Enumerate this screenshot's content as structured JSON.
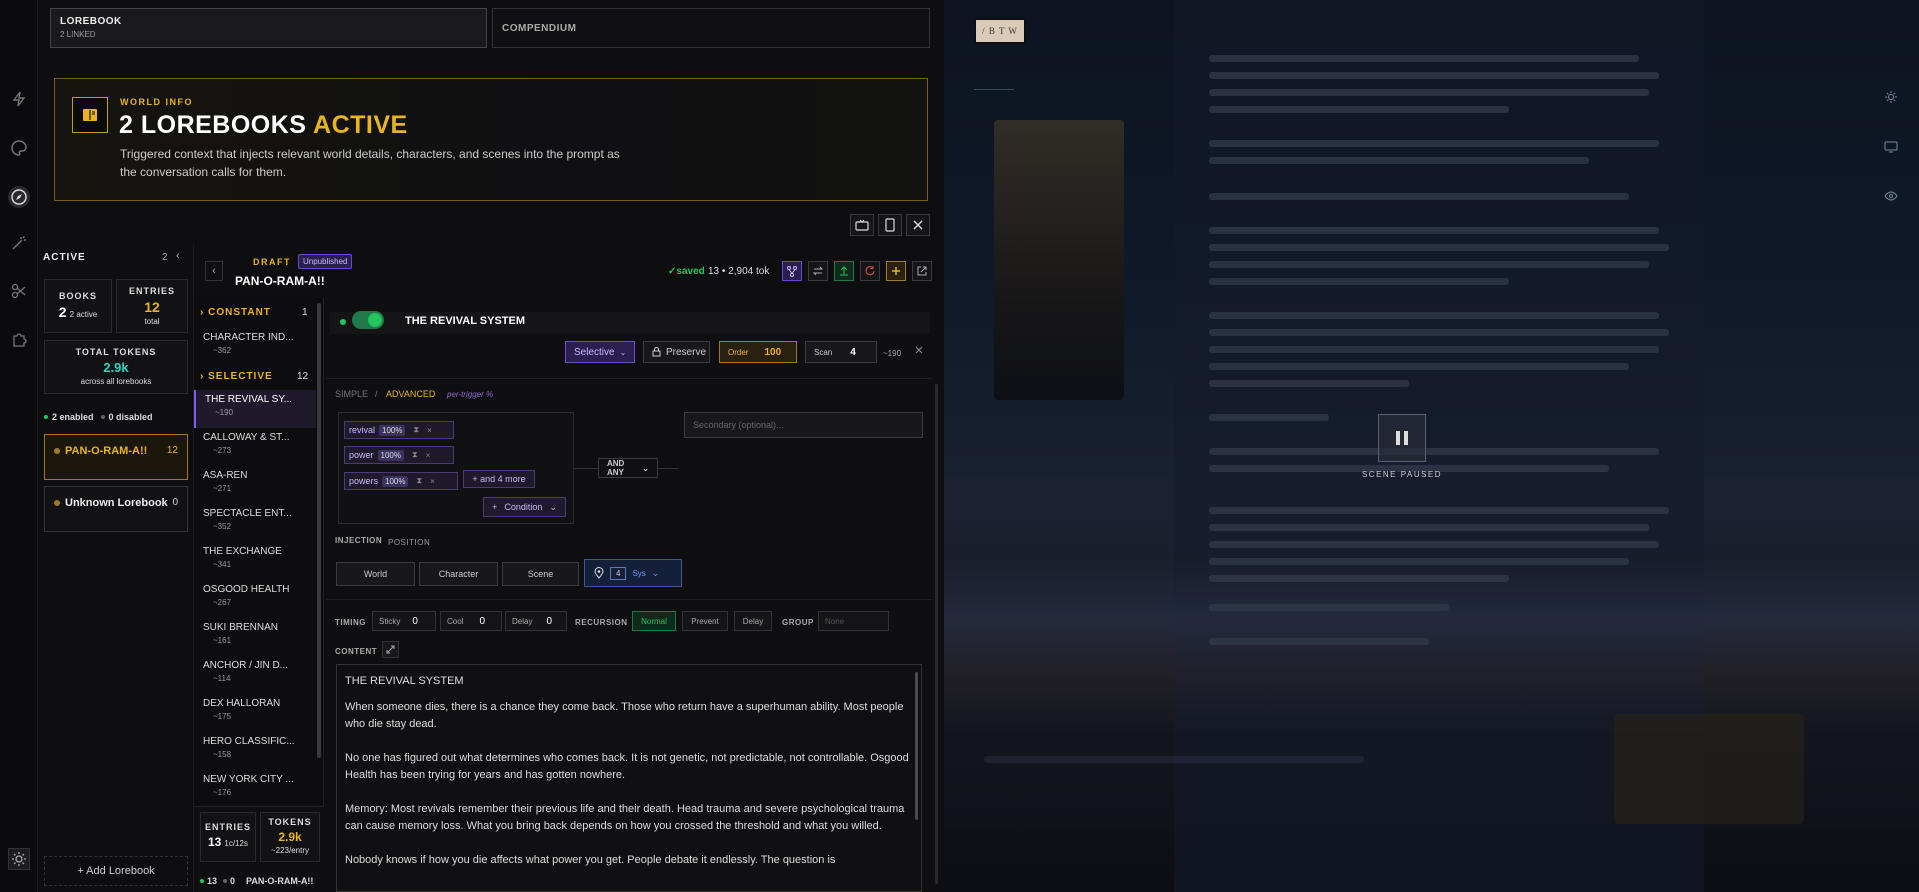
{
  "top_tabs": [
    {
      "label": "LOREBOOK",
      "sub": "2 LINKED"
    },
    {
      "label": "COMPENDIUM",
      "sub": ""
    }
  ],
  "world_info": {
    "eyebrow": "WORLD INFO",
    "title_prefix": "2 LOREBOOKS",
    "title_accent": "ACTIVE",
    "description": "Triggered context that injects relevant world details, characters, and scenes into the prompt as the conversation calls for them."
  },
  "sidebar": {
    "header": "ACTIVE",
    "count": "2",
    "books_label": "BOOKS",
    "books_value": "2",
    "books_sub": "2 active",
    "entries_label": "ENTRIES",
    "entries_value": "12",
    "entries_sub": "total",
    "tokens_label": "TOTAL TOKENS",
    "tokens_value": "2.9k",
    "tokens_sub": "across all lorebooks",
    "enabled": "2 enabled",
    "disabled": "0 disabled",
    "books": [
      {
        "name": "PAN-O-RAM-A!!",
        "count": "12"
      },
      {
        "name": "Unknown Lorebook",
        "count": "0"
      }
    ],
    "add_label": "+ Add Lorebook"
  },
  "editor_header": {
    "draft": "DRAFT",
    "badge": "Unpublished",
    "book_title": "PAN-O-RAM-A!!",
    "saved": "✓saved",
    "stats": "13 • 2,904 tok"
  },
  "entry_list": {
    "constant_label": "CONSTANT",
    "constant_count": "1",
    "selective_label": "SELECTIVE",
    "selective_count": "12",
    "constant": [
      {
        "name": "CHARACTER IND...",
        "tok": "~362"
      }
    ],
    "selective": [
      {
        "name": "THE REVIVAL SY...",
        "tok": "~190"
      },
      {
        "name": "CALLOWAY & ST...",
        "tok": "~273"
      },
      {
        "name": "ASA-REN",
        "tok": "~271"
      },
      {
        "name": "SPECTACLE ENT...",
        "tok": "~352"
      },
      {
        "name": "THE EXCHANGE",
        "tok": "~341"
      },
      {
        "name": "OSGOOD HEALTH",
        "tok": "~267"
      },
      {
        "name": "SUKI BRENNAN",
        "tok": "~161"
      },
      {
        "name": "ANCHOR / JIN D...",
        "tok": "~114"
      },
      {
        "name": "DEX HALLORAN",
        "tok": "~175"
      },
      {
        "name": "HERO CLASSIFIC...",
        "tok": "~158"
      },
      {
        "name": "NEW YORK CITY ...",
        "tok": "~176"
      }
    ],
    "footer_entries_label": "ENTRIES",
    "footer_entries_value": "13",
    "footer_entries_sub": "1c/12s",
    "footer_tokens_label": "TOKENS",
    "footer_tokens_value": "2.9k",
    "footer_tokens_sub": "~223/entry",
    "footer_line_a": "13",
    "footer_line_b": "0",
    "footer_book": "PAN-O-RAM-A!!"
  },
  "entry_editor": {
    "title": "THE REVIVAL SYSTEM",
    "mode": "Selective",
    "preserve": "Preserve",
    "order_label": "Order",
    "order_value": "100",
    "scan_label": "Scan",
    "scan_value": "4",
    "tok": "~190",
    "simple": "SIMPLE",
    "sep": "/",
    "advanced": "ADVANCED",
    "per_trigger": "per-trigger %",
    "keys": [
      {
        "key": "revival",
        "pct": "100%"
      },
      {
        "key": "power",
        "pct": "100%"
      },
      {
        "key": "powers",
        "pct": "100%"
      }
    ],
    "more": "+ and 4 more",
    "condition": "Condition",
    "logic": "AND ANY",
    "secondary_placeholder": "Secondary (optional)...",
    "injection_label": "INJECTION",
    "position_label": "POSITION",
    "inj_world": "World",
    "inj_character": "Character",
    "inj_scene": "Scene",
    "inj_depth": "4",
    "inj_role": "Sys",
    "timing_label": "TIMING",
    "sticky_label": "Sticky",
    "sticky": "0",
    "cool_label": "Cool",
    "cool": "0",
    "delay_label": "Delay",
    "delay": "0",
    "recursion_label": "RECURSION",
    "rec_normal": "Normal",
    "rec_prevent": "Prevent",
    "rec_delay": "Delay",
    "group_label": "GROUP",
    "group_placeholder": "None",
    "content_label": "CONTENT",
    "content": [
      "THE REVIVAL SYSTEM",
      "When someone dies, there is a chance they come back. Those who return have a superhuman ability. Most people who die stay dead.",
      "No one has figured out what determines who comes back. It is not genetic, not predictable, not controllable. Osgood Health has been trying for years and has gotten nowhere.",
      "Memory: Most revivals remember their previous life and their death. Head trauma and severe psychological trauma can cause memory loss. What you bring back depends on how you crossed the threshold and what you willed.",
      "Nobody knows if how you die affects what power you get. People debate it endlessly. The question is"
    ]
  },
  "scene": {
    "btw": "/ B T W",
    "paused": "SCENE PAUSED"
  },
  "colors": {
    "accent": "#e8b422",
    "purple": "#7c5cff",
    "green": "#22c55e",
    "teal": "#2dd4bf"
  }
}
